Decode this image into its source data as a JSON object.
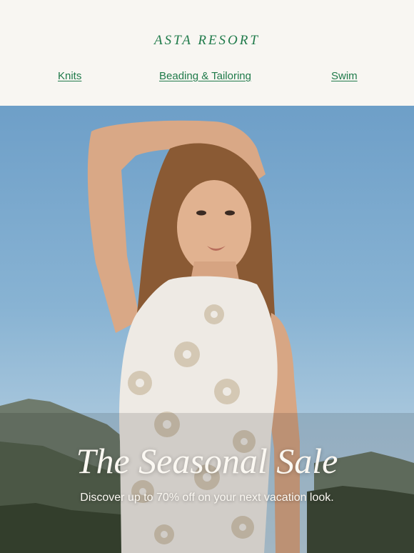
{
  "header": {
    "brand": "ASTA RESORT",
    "nav": [
      "Knits",
      "Beading & Tailoring",
      "Swim"
    ]
  },
  "hero": {
    "headline": "The Seasonal Sale",
    "subline": "Discover up to 70% off on your next vacation look.",
    "image_alt": "Model in white crochet floral dress, arm raised, against blue sky and mountains"
  },
  "colors": {
    "brand_green": "#1f7a4a",
    "background": "#f8f6f2",
    "hero_text": "#fbf8f2"
  }
}
